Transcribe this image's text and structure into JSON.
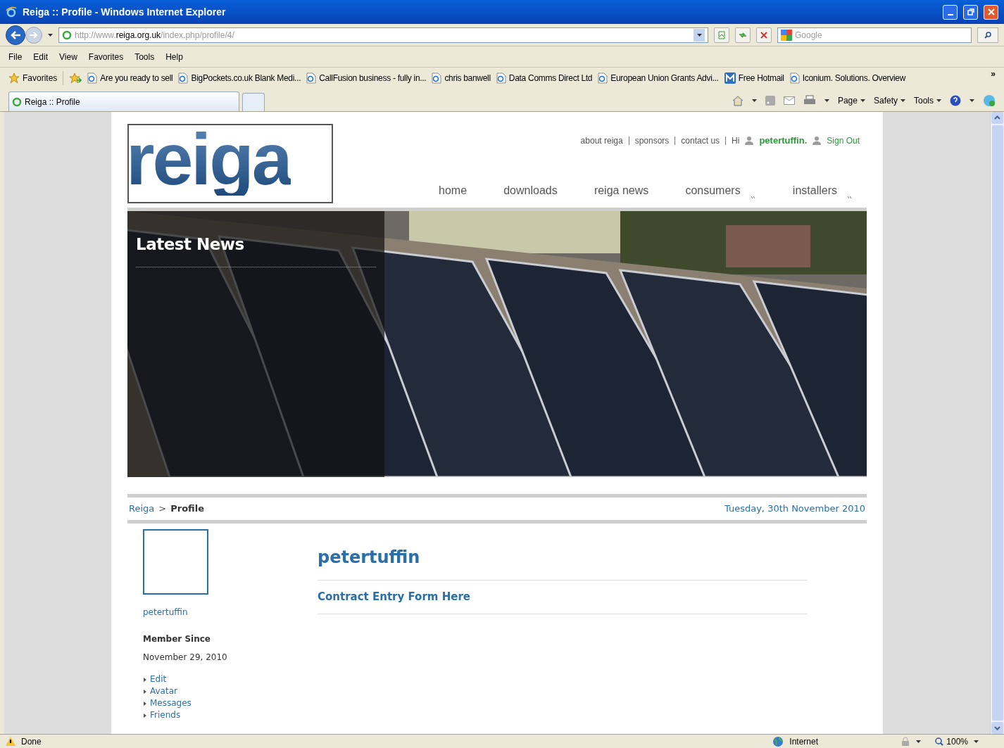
{
  "window": {
    "title": "Reiga :: Profile - Windows Internet Explorer"
  },
  "address_bar": {
    "prefix": "http://www.",
    "domain": "reiga.org.uk",
    "path": "/index.php/profile/4/"
  },
  "search": {
    "placeholder": "Google"
  },
  "menu": [
    "File",
    "Edit",
    "View",
    "Favorites",
    "Tools",
    "Help"
  ],
  "favorites_bar": {
    "label": "Favorites",
    "items": [
      {
        "label": "Are you ready to sell",
        "kind": "ie"
      },
      {
        "label": "BigPockets.co.uk Blank Medi...",
        "kind": "ie"
      },
      {
        "label": "CallFusion business - fully in...",
        "kind": "ie"
      },
      {
        "label": "chris banwell",
        "kind": "ie"
      },
      {
        "label": "Data Comms Direct Ltd",
        "kind": "ie"
      },
      {
        "label": "European Union Grants Advi...",
        "kind": "ie"
      },
      {
        "label": "Free Hotmail",
        "kind": "hotmail"
      },
      {
        "label": "Iconium. Solutions. Overview",
        "kind": "ie"
      }
    ],
    "more": "»"
  },
  "tabs": [
    {
      "label": "Reiga :: Profile",
      "selected": true
    }
  ],
  "command_bar": [
    "Page",
    "Safety",
    "Tools"
  ],
  "page": {
    "logo": "reiga",
    "top_links": [
      "about reiga",
      "sponsors",
      "contact us"
    ],
    "greeting": "Hi",
    "user": "petertuffin.",
    "sign_out": "Sign Out",
    "nav": [
      {
        "label": "home",
        "dropdown": false
      },
      {
        "label": "downloads",
        "dropdown": false
      },
      {
        "label": "reiga news",
        "dropdown": false
      },
      {
        "label": "consumers",
        "dropdown": true
      },
      {
        "label": "installers",
        "dropdown": true
      }
    ],
    "hero": {
      "title": "Latest News"
    },
    "breadcrumb": {
      "root": "Reiga",
      "separator": ">",
      "current": "Profile"
    },
    "date": "Tuesday, 30th November 2010",
    "sidebar": {
      "username": "petertuffin",
      "member_since_label": "Member Since",
      "member_since": "November 29, 2010",
      "links": [
        "Edit",
        "Avatar",
        "Messages",
        "Friends"
      ]
    },
    "profile": {
      "name": "petertuffin",
      "link": "Contract Entry Form Here"
    }
  },
  "status_bar": {
    "text": "Done",
    "zone": "Internet",
    "zoom": "100%"
  }
}
